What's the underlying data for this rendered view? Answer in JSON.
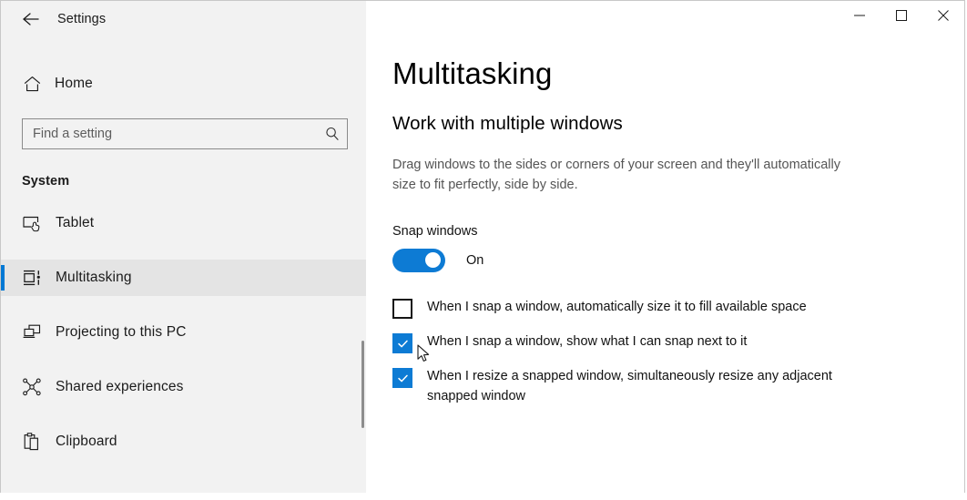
{
  "window": {
    "app_title": "Settings",
    "back_icon": "back-arrow-icon",
    "controls": {
      "minimize_label": "Minimize",
      "maximize_label": "Maximize",
      "close_label": "Close"
    }
  },
  "sidebar": {
    "home": {
      "label": "Home",
      "icon": "home-icon"
    },
    "search": {
      "value": "",
      "placeholder": "Find a setting",
      "icon": "search-icon"
    },
    "group_heading": "System",
    "items": [
      {
        "label": "Tablet",
        "icon": "tablet-icon",
        "selected": false
      },
      {
        "label": "Multitasking",
        "icon": "multitasking-icon",
        "selected": true
      },
      {
        "label": "Projecting to this PC",
        "icon": "projecting-icon",
        "selected": false
      },
      {
        "label": "Shared experiences",
        "icon": "shared-experiences-icon",
        "selected": false
      },
      {
        "label": "Clipboard",
        "icon": "clipboard-icon",
        "selected": false
      }
    ]
  },
  "main": {
    "page_title": "Multitasking",
    "section_title": "Work with multiple windows",
    "description": "Drag windows to the sides or corners of your screen and they'll automatically size to fit perfectly, side by side.",
    "snap": {
      "label": "Snap windows",
      "toggle_state": "On",
      "toggle_on": true,
      "accent_color": "#0d7bd4"
    },
    "checkboxes": [
      {
        "label": "When I snap a window, automatically size it to fill available space",
        "checked": false
      },
      {
        "label": "When I snap a window, show what I can snap next to it",
        "checked": true
      },
      {
        "label": "When I resize a snapped window, simultaneously resize any adjacent snapped window",
        "checked": true
      }
    ]
  },
  "cursor": {
    "icon": "mouse-pointer-icon"
  }
}
